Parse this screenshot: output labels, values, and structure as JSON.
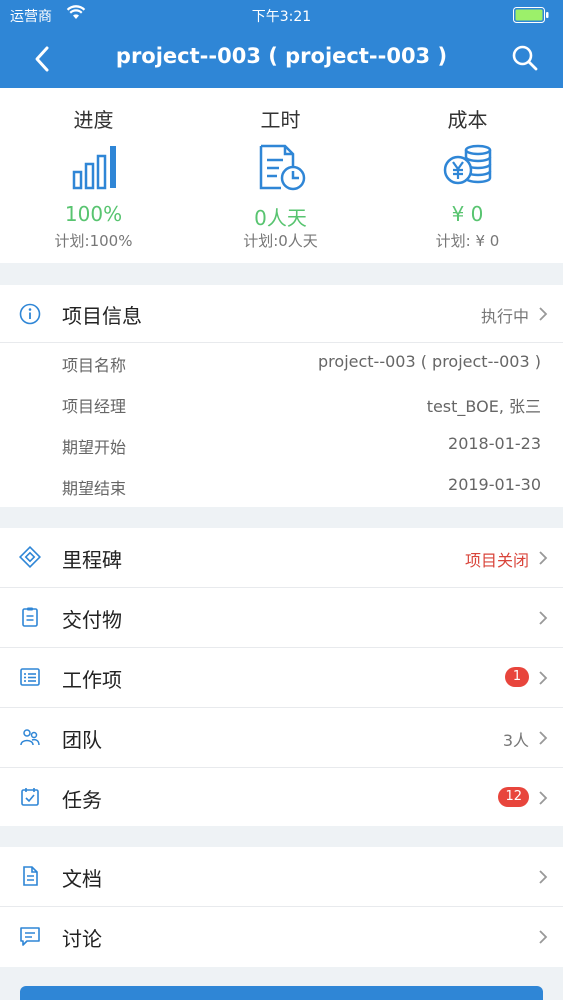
{
  "status": {
    "carrier": "运营商",
    "time": "下午3:21"
  },
  "nav": {
    "title": "project--003 ( project--003 )"
  },
  "metrics": [
    {
      "label": "进度",
      "value": "100%",
      "plan": "计划:100%",
      "icon": "bar-chart-icon"
    },
    {
      "label": "工时",
      "value": "0人天",
      "plan": "计划:0人天",
      "icon": "timesheet-icon"
    },
    {
      "label": "成本",
      "value": "¥ 0",
      "plan": "计划: ¥ 0",
      "icon": "coins-icon"
    }
  ],
  "project_info": {
    "label": "项目信息",
    "status": "执行中",
    "details": [
      {
        "label": "项目名称",
        "value": "project--003 ( project--003 )"
      },
      {
        "label": "项目经理",
        "value": "test_BOE, 张三"
      },
      {
        "label": "期望开始",
        "value": "2018-01-23"
      },
      {
        "label": "期望结束",
        "value": "2019-01-30"
      }
    ]
  },
  "menu": [
    {
      "label": "里程碑",
      "value": "项目关闭",
      "icon": "milestone-icon"
    },
    {
      "label": "交付物",
      "value": "",
      "icon": "clipboard-icon"
    },
    {
      "label": "工作项",
      "badge": "1",
      "icon": "list-icon"
    },
    {
      "label": "团队",
      "value": "3人",
      "icon": "team-icon"
    },
    {
      "label": "任务",
      "badge": "12",
      "icon": "calendar-check-icon"
    }
  ],
  "docs": [
    {
      "label": "文档",
      "icon": "document-icon"
    },
    {
      "label": "讨论",
      "icon": "chat-icon"
    }
  ],
  "colors": {
    "primary": "#2f86d6",
    "success": "#58c470",
    "danger": "#e8453c"
  }
}
